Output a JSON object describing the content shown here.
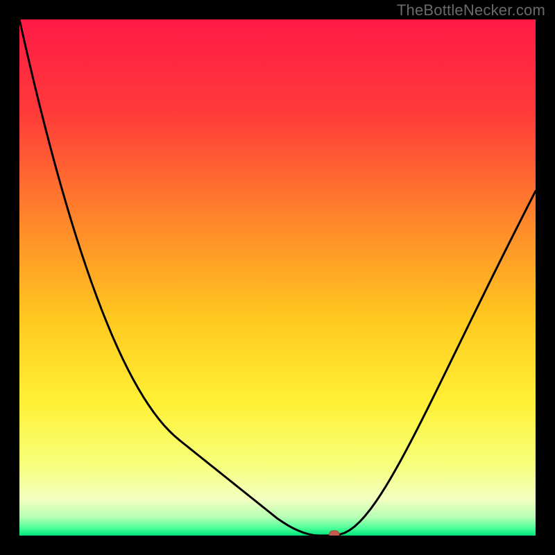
{
  "watermark": "TheBottleNecker.com",
  "colors": {
    "frame": "#000000",
    "curve": "#000000",
    "marker_fill": "#c45a52",
    "marker_stroke": "#b0433c",
    "gradient_stops": [
      {
        "offset": 0.0,
        "color": "#ff1a46"
      },
      {
        "offset": 0.18,
        "color": "#ff3a3a"
      },
      {
        "offset": 0.4,
        "color": "#ff8a2a"
      },
      {
        "offset": 0.58,
        "color": "#ffc81f"
      },
      {
        "offset": 0.74,
        "color": "#fff035"
      },
      {
        "offset": 0.86,
        "color": "#f7ff7a"
      },
      {
        "offset": 0.93,
        "color": "#f2ffc0"
      },
      {
        "offset": 0.965,
        "color": "#b4ffb4"
      },
      {
        "offset": 0.985,
        "color": "#4eff9a"
      },
      {
        "offset": 1.0,
        "color": "#00e57a"
      }
    ]
  },
  "chart_data": {
    "type": "line",
    "title": "",
    "xlabel": "",
    "ylabel": "",
    "xlim": [
      0,
      100
    ],
    "ylim": [
      0,
      100
    ],
    "x": [
      0,
      1,
      2,
      3,
      4,
      5,
      6,
      7,
      8,
      9,
      10,
      11,
      12,
      13,
      14,
      15,
      16,
      17,
      18,
      19,
      20,
      21,
      22,
      23,
      24,
      25,
      26,
      27,
      28,
      29,
      30,
      31,
      32,
      33,
      34,
      35,
      36,
      37,
      38,
      39,
      40,
      41,
      42,
      43,
      44,
      45,
      46,
      47,
      48,
      49,
      50,
      51,
      52,
      53,
      54,
      55,
      56,
      57,
      58,
      59,
      60,
      61,
      62,
      63,
      64,
      65,
      66,
      67,
      68,
      69,
      70,
      71,
      72,
      73,
      74,
      75,
      76,
      77,
      78,
      79,
      80,
      81,
      82,
      83,
      84,
      85,
      86,
      87,
      88,
      89,
      90,
      91,
      92,
      93,
      94,
      95,
      96,
      97,
      98,
      99,
      100
    ],
    "values": [
      100,
      95.57,
      91.26,
      87.07,
      83.01,
      79.06,
      75.23,
      71.53,
      67.94,
      64.48,
      61.13,
      57.91,
      54.8,
      51.82,
      48.95,
      46.21,
      43.58,
      41.08,
      38.69,
      36.42,
      34.28,
      32.25,
      30.34,
      28.55,
      26.88,
      25.33,
      23.89,
      22.58,
      21.38,
      20.31,
      19.35,
      18.49,
      17.69,
      16.89,
      16.09,
      15.29,
      14.49,
      13.69,
      12.89,
      12.09,
      11.29,
      10.49,
      9.69,
      8.89,
      8.09,
      7.29,
      6.49,
      5.69,
      4.89,
      4.09,
      3.29,
      2.62,
      1.99,
      1.44,
      0.97,
      0.58,
      0.28,
      0.07,
      0,
      0,
      0,
      0,
      0.2,
      0.52,
      1.06,
      1.81,
      2.75,
      3.85,
      5.1,
      6.48,
      7.97,
      9.56,
      11.23,
      12.98,
      14.78,
      16.64,
      18.54,
      20.48,
      22.45,
      24.44,
      26.45,
      28.48,
      30.51,
      32.55,
      34.6,
      36.64,
      38.69,
      40.74,
      42.78,
      44.82,
      46.85,
      48.88,
      50.9,
      52.91,
      54.91,
      56.91,
      58.9,
      60.88,
      62.85,
      64.81,
      66.76
    ],
    "marker": {
      "x": 61,
      "y": 0
    }
  }
}
